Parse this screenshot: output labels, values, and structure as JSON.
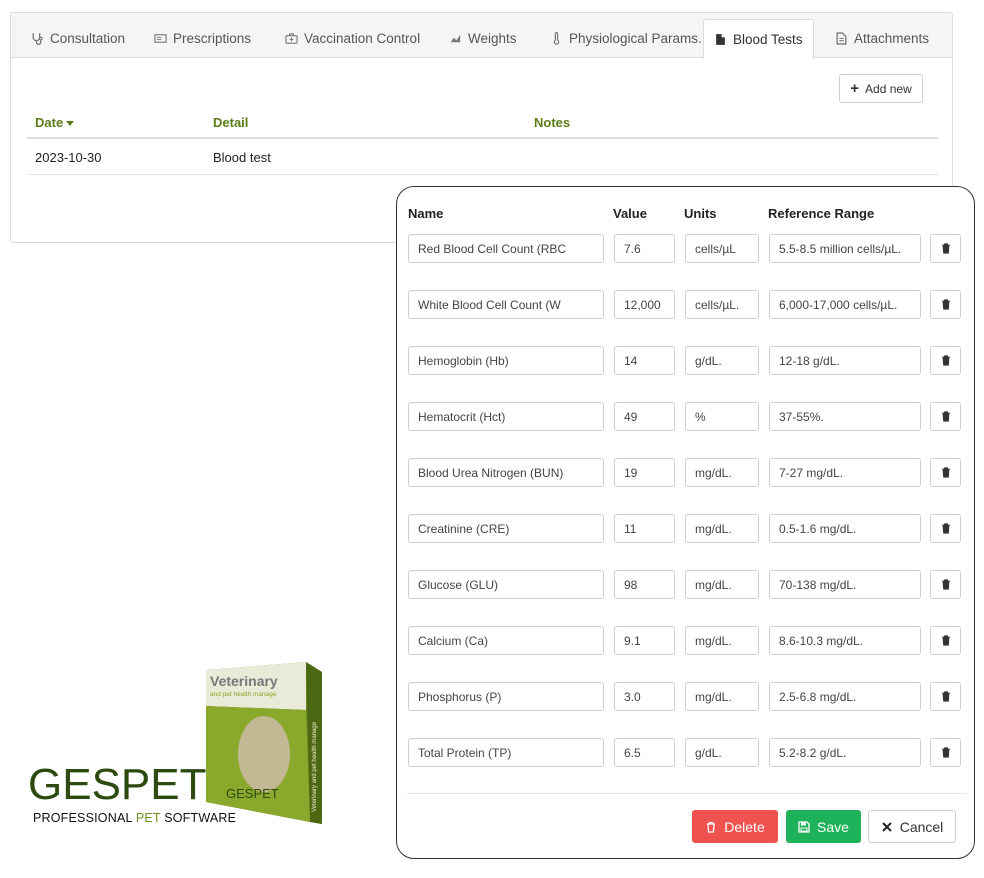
{
  "tabs": [
    {
      "label": "Consultation",
      "icon": "stethoscope-icon"
    },
    {
      "label": "Prescriptions",
      "icon": "prescription-icon"
    },
    {
      "label": "Vaccination Control",
      "icon": "medkit-icon"
    },
    {
      "label": "Weights",
      "icon": "area-chart-icon"
    },
    {
      "label": "Physiological Params.",
      "icon": "thermometer-icon"
    },
    {
      "label": "Blood Tests",
      "icon": "document-icon",
      "active": true
    },
    {
      "label": "Attachments",
      "icon": "attachment-icon"
    }
  ],
  "toolbar": {
    "add_new_label": "Add new"
  },
  "list": {
    "columns": {
      "date": "Date",
      "detail": "Detail",
      "notes": "Notes"
    },
    "rows": [
      {
        "date": "2023-10-30",
        "detail": "Blood test",
        "notes": ""
      }
    ]
  },
  "modal": {
    "columns": {
      "name": "Name",
      "value": "Value",
      "units": "Units",
      "reference_range": "Reference Range"
    },
    "rows": [
      {
        "name": "Red Blood Cell Count (RBC",
        "value": "7.6",
        "units": "cells/µL",
        "range": "5.5-8.5 million cells/µL."
      },
      {
        "name": "White Blood Cell Count (W",
        "value": "12,000",
        "units": "cells/µL.",
        "range": "6,000-17,000 cells/µL."
      },
      {
        "name": "Hemoglobin (Hb)",
        "value": "14",
        "units": "g/dL.",
        "range": "12-18 g/dL."
      },
      {
        "name": "Hematocrit (Hct)",
        "value": "49",
        "units": "%",
        "range": "37-55%."
      },
      {
        "name": "Blood Urea Nitrogen (BUN)",
        "value": "19",
        "units": "mg/dL.",
        "range": "7-27 mg/dL."
      },
      {
        "name": "Creatinine (CRE)",
        "value": "11",
        "units": "mg/dL.",
        "range": "0.5-1.6 mg/dL."
      },
      {
        "name": "Glucose (GLU)",
        "value": "98",
        "units": "mg/dL.",
        "range": "70-138 mg/dL."
      },
      {
        "name": "Calcium (Ca)",
        "value": "9.1",
        "units": "mg/dL.",
        "range": "8.6-10.3 mg/dL."
      },
      {
        "name": "Phosphorus (P)",
        "value": "3.0",
        "units": "mg/dL.",
        "range": "2.5-6.8 mg/dL."
      },
      {
        "name": "Total Protein (TP)",
        "value": "6.5",
        "units": "g/dL.",
        "range": "5.2-8.2 g/dL."
      }
    ],
    "buttons": {
      "delete": "Delete",
      "save": "Save",
      "cancel": "Cancel"
    }
  },
  "branding": {
    "logo_ges": "GES",
    "logo_pet": "PET",
    "tagline_a": "PROFESSIONAL ",
    "tagline_b": "PET",
    "tagline_c": " SOFTWARE",
    "box_title": "Veterinary",
    "box_subtitle": "and pet health manage",
    "box_side": "Veterinary and pet health manage",
    "box_logo": "GESPET"
  },
  "colors": {
    "accent_green": "#5a7d17",
    "delete_red": "#f0524f",
    "save_green": "#1eb35a",
    "logo_dark_green": "#2d4a10"
  }
}
